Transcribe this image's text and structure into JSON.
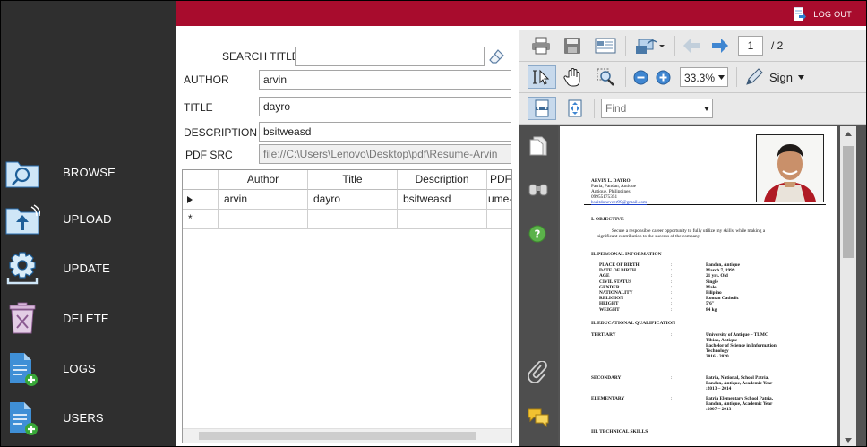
{
  "sidebar": {
    "items": [
      {
        "label": "BROWSE",
        "icon": "folder-search-icon"
      },
      {
        "label": "UPLOAD",
        "icon": "folder-upload-icon"
      },
      {
        "label": "UPDATE",
        "icon": "gear-icon"
      },
      {
        "label": "DELETE",
        "icon": "trash-icon"
      },
      {
        "label": "LOGS",
        "icon": "document-add-icon"
      },
      {
        "label": "USERS",
        "icon": "document-add-icon"
      }
    ]
  },
  "header": {
    "logout_label": "LOG OUT",
    "color": "#a80c2d"
  },
  "form": {
    "search_label": "SEARCH TITLE",
    "search_value": "",
    "author_label": "AUTHOR",
    "author_value": "arvin",
    "title_label": "TITLE",
    "title_value": "dayro",
    "description_label": "DESCRIPTION",
    "description_value": "bsitweasd",
    "pdfsrc_label": "PDF SRC",
    "pdfsrc_value": "file://C:\\Users\\Lenovo\\Desktop\\pdf\\Resume-Arvin"
  },
  "grid": {
    "columns": [
      "Author",
      "Title",
      "Description",
      "PDF"
    ],
    "rows": [
      {
        "author": "arvin",
        "title": "dayro",
        "description": "bsitweasd",
        "pdf": "ume-"
      }
    ],
    "new_row_marker": "*"
  },
  "pdf_viewer": {
    "page_current": "1",
    "page_total": "/ 2",
    "zoom": "33.3%",
    "sign_label": "Sign",
    "find_placeholder": "Find"
  },
  "resume": {
    "name": "ARVIN L. DAYRO",
    "address1": "Patria, Pandan, Antique",
    "address2": "Antique, Philippines",
    "phone": "09955175351",
    "email": "bsaitdoneveer99@gmail.com",
    "objective_title": "I.  OBJECTIVE",
    "objective_line1": "Secure a responsible career opportunity to fully utilize my skills, while making a",
    "objective_line2": "significant contribution to the success of the company.",
    "personal_title": "II.  PERSONAL INFORMATION",
    "personal": [
      {
        "k": "PLACE OF BIRTH",
        "v": "Pandan, Antique"
      },
      {
        "k": "DATE OF BIRTH",
        "v": "March 7, 1999"
      },
      {
        "k": "AGE",
        "v": "21 yrs. Old"
      },
      {
        "k": "CIVIL STATUS",
        "v": "Single"
      },
      {
        "k": "GENDER",
        "v": "Male"
      },
      {
        "k": "NATIONALITY",
        "v": "Filipino"
      },
      {
        "k": "RELIGION",
        "v": "Roman Catholic"
      },
      {
        "k": "HEIGHT",
        "v": "5'6\""
      },
      {
        "k": "WEIGHT",
        "v": "84 kg"
      }
    ],
    "educ_title": "II.  EDUCATIONAL QUALIFICATION",
    "tertiary_k": "TERTIARY",
    "tertiary_v": [
      "University of Antique – TLMC",
      "Tibiao, Antique",
      "Bachelor  of  Science  in  Information",
      "Technology",
      "2016 - 2020"
    ],
    "secondary_k": "SECONDARY",
    "secondary_v": [
      "Patria, National, School Patria,",
      "Pandan, Antique, Academic Year",
      ":2013 – 2014"
    ],
    "elementary_k": "ELEMENTARY",
    "elementary_v": [
      "Patria Elementary School Patria,",
      "Pandan, Antique, Academic Year",
      ":2007 – 2013"
    ],
    "skills_title": "III.  TECHNICAL SKILLS"
  }
}
